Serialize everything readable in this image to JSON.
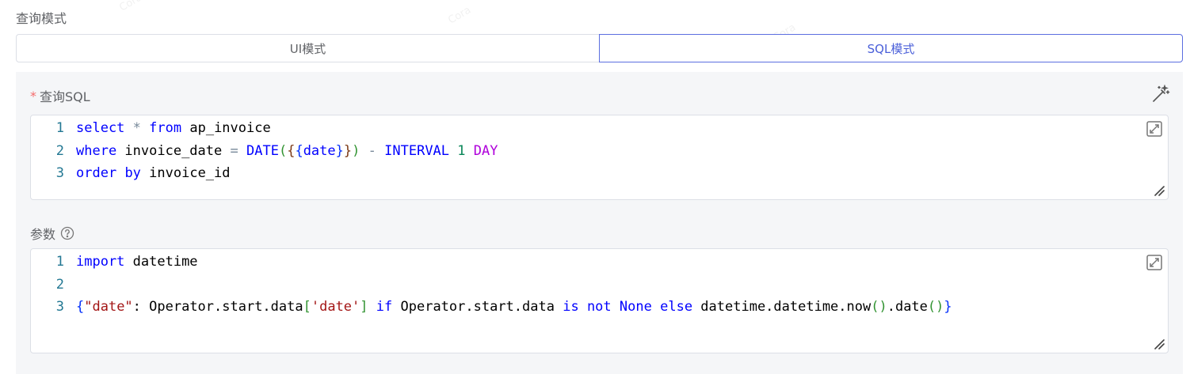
{
  "query_mode": {
    "label": "查询模式",
    "options": [
      "UI模式",
      "SQL模式"
    ],
    "selected": "SQL模式"
  },
  "sql_field": {
    "required_mark": "*",
    "label": "查询SQL",
    "lines": [
      {
        "n": "1",
        "tokens": [
          [
            "kw",
            "select"
          ],
          [
            "plain",
            " "
          ],
          [
            "op",
            "*"
          ],
          [
            "plain",
            " "
          ],
          [
            "kw",
            "from"
          ],
          [
            "plain",
            " ap_invoice"
          ]
        ]
      },
      {
        "n": "2",
        "tokens": [
          [
            "kw",
            "where"
          ],
          [
            "plain",
            " invoice_date "
          ],
          [
            "op",
            "="
          ],
          [
            "plain",
            " "
          ],
          [
            "fn",
            "DATE"
          ],
          [
            "p1",
            "("
          ],
          [
            "p2",
            "{"
          ],
          [
            "p3",
            "{"
          ],
          [
            "fn",
            "date"
          ],
          [
            "p3",
            "}"
          ],
          [
            "p2",
            "}"
          ],
          [
            "p1",
            ")"
          ],
          [
            "plain",
            " "
          ],
          [
            "op",
            "-"
          ],
          [
            "plain",
            " "
          ],
          [
            "fn",
            "INTERVAL"
          ],
          [
            "plain",
            " "
          ],
          [
            "num",
            "1"
          ],
          [
            "plain",
            " "
          ],
          [
            "unit",
            "DAY"
          ]
        ]
      },
      {
        "n": "3",
        "tokens": [
          [
            "kw",
            "order"
          ],
          [
            "plain",
            " "
          ],
          [
            "kw",
            "by"
          ],
          [
            "plain",
            " invoice_id"
          ]
        ]
      }
    ]
  },
  "params_field": {
    "label": "参数",
    "lines": [
      {
        "n": "1",
        "tokens": [
          [
            "kw",
            "import"
          ],
          [
            "plain",
            " datetime"
          ]
        ]
      },
      {
        "n": "2",
        "tokens": []
      },
      {
        "n": "3",
        "tokens": [
          [
            "p3",
            "{"
          ],
          [
            "str",
            "\"date\""
          ],
          [
            "plain",
            ": Operator.start.data"
          ],
          [
            "p1",
            "["
          ],
          [
            "str",
            "'date'"
          ],
          [
            "p1",
            "]"
          ],
          [
            "plain",
            " "
          ],
          [
            "kw",
            "if"
          ],
          [
            "plain",
            " Operator.start.data "
          ],
          [
            "kw",
            "is"
          ],
          [
            "plain",
            " "
          ],
          [
            "kw",
            "not"
          ],
          [
            "plain",
            " "
          ],
          [
            "kw",
            "None"
          ],
          [
            "plain",
            " "
          ],
          [
            "kw",
            "else"
          ],
          [
            "plain",
            " datetime.datetime.now"
          ],
          [
            "p1",
            "()"
          ],
          [
            "plain",
            ".date"
          ],
          [
            "p1",
            "()"
          ],
          [
            "p3",
            "}"
          ]
        ]
      }
    ]
  },
  "watermark": "Cora",
  "icons": {
    "magic": "magic-wand-icon",
    "expand": "expand-icon",
    "resize": "resize-handle-icon",
    "help": "question-circle-icon"
  },
  "colors": {
    "accent": "#4a5fd9",
    "required": "#f56c6c",
    "panel_bg": "#f5f6f8"
  }
}
